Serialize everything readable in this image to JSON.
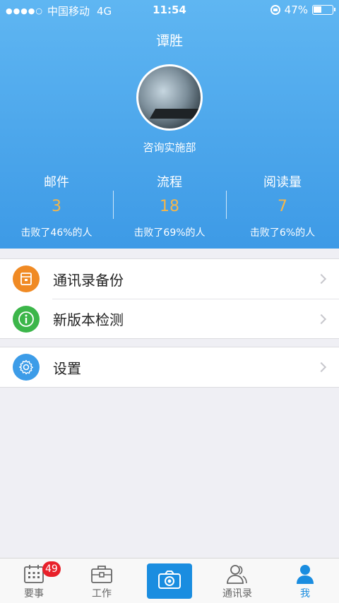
{
  "status_bar": {
    "signal_dots": "●●●●○",
    "carrier": "中国移动",
    "network": "4G",
    "time": "11:54",
    "battery": "47%",
    "battery_level": 0.47
  },
  "profile": {
    "name": "谭胜",
    "department": "咨询实施部"
  },
  "stats": [
    {
      "label": "邮件",
      "value": "3",
      "desc": "击败了46%的人"
    },
    {
      "label": "流程",
      "value": "18",
      "desc": "击败了69%的人"
    },
    {
      "label": "阅读量",
      "value": "7",
      "desc": "击败了6%的人"
    }
  ],
  "menu": {
    "backup_label": "通讯录备份",
    "version_label": "新版本检测",
    "settings_label": "设置"
  },
  "colors": {
    "accent": "#1a8de0",
    "stat_value": "#f5b64a",
    "backup_icon_bg": "#f08a24",
    "version_icon_bg": "#3cb64a",
    "settings_icon_bg": "#3c9ce8",
    "badge": "#e8202a"
  },
  "tabbar": {
    "tabs": [
      {
        "label": "要事",
        "icon": "calendar-icon",
        "badge": "49"
      },
      {
        "label": "工作",
        "icon": "briefcase-icon"
      },
      {
        "label": "",
        "icon": "camera-icon"
      },
      {
        "label": "通讯录",
        "icon": "contacts-icon"
      },
      {
        "label": "我",
        "icon": "person-icon"
      }
    ]
  }
}
